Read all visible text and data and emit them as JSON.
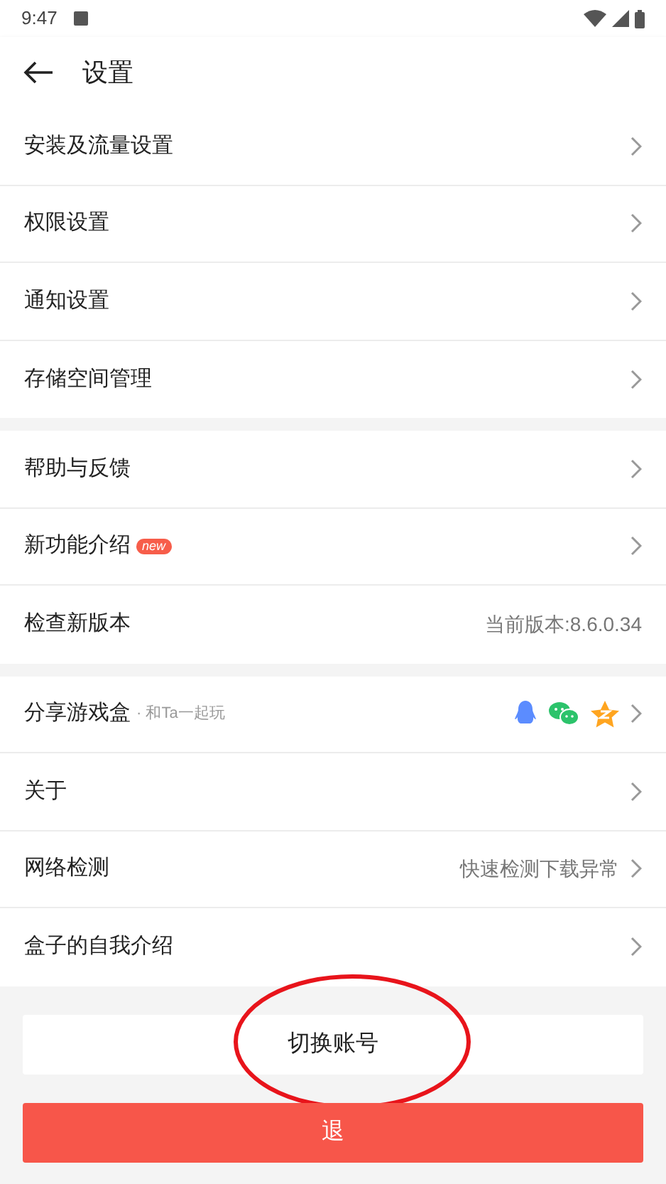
{
  "status_bar": {
    "time": "9:47"
  },
  "header": {
    "title": "设置"
  },
  "groups": [
    {
      "items": [
        {
          "kind": "link",
          "label": "安装及流量设置"
        },
        {
          "kind": "link",
          "label": "权限设置"
        },
        {
          "kind": "link",
          "label": "通知设置"
        },
        {
          "kind": "link",
          "label": "存储空间管理"
        }
      ]
    },
    {
      "items": [
        {
          "kind": "link",
          "label": "帮助与反馈"
        },
        {
          "kind": "link",
          "label": "新功能介绍",
          "badge": "new"
        },
        {
          "kind": "value",
          "label": "检查新版本",
          "value": "当前版本:8.6.0.34"
        }
      ]
    },
    {
      "items": [
        {
          "kind": "share",
          "label": "分享游戏盒",
          "sublabel": "· 和Ta一起玩"
        },
        {
          "kind": "link",
          "label": "关于"
        },
        {
          "kind": "link",
          "label": "网络检测",
          "value": "快速检测下载异常"
        },
        {
          "kind": "link",
          "label": "盒子的自我介绍"
        }
      ]
    }
  ],
  "buttons": [
    {
      "kind": "plain",
      "label": "切换账号",
      "circled": true
    },
    {
      "kind": "danger",
      "label": "退",
      "circled": false
    }
  ]
}
